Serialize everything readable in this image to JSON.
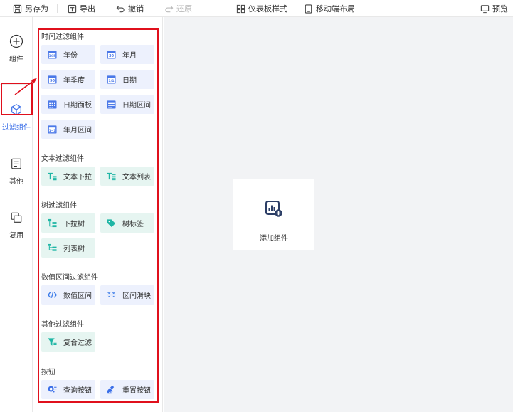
{
  "toolbar": {
    "save_as": "另存为",
    "export": "导出",
    "undo": "撤销",
    "redo": "还原",
    "dashboard_style": "仪表板样式",
    "mobile_layout": "移动端布局",
    "preview": "预览"
  },
  "rail": {
    "items": [
      {
        "label": "组件",
        "icon": "plus-circle-icon"
      },
      {
        "label": "过滤组件",
        "icon": "cube-icon",
        "active": true
      },
      {
        "label": "其他",
        "icon": "document-icon"
      },
      {
        "label": "复用",
        "icon": "copy-icon"
      }
    ]
  },
  "panel": {
    "sections": [
      {
        "title": "时间过滤组件",
        "items": [
          {
            "label": "年份",
            "icon": "calendar-365-icon",
            "color": "#4a78e8"
          },
          {
            "label": "年月",
            "icon": "calendar-30-icon",
            "color": "#4a78e8"
          },
          {
            "label": "年季度",
            "icon": "calendar-90-icon",
            "color": "#4a78e8"
          },
          {
            "label": "日期",
            "icon": "calendar-1-1-icon",
            "color": "#4a78e8"
          },
          {
            "label": "日期面板",
            "icon": "calendar-grid-icon",
            "color": "#4a78e8"
          },
          {
            "label": "日期区间",
            "icon": "calendar-range-icon",
            "color": "#4a78e8"
          },
          {
            "label": "年月区间",
            "icon": "calendar-month-range-icon",
            "color": "#4a78e8"
          }
        ]
      },
      {
        "title": "文本过滤组件",
        "items": [
          {
            "label": "文本下拉",
            "icon": "text-dropdown-icon",
            "color": "#1fb6a5"
          },
          {
            "label": "文本列表",
            "icon": "text-list-icon",
            "color": "#1fb6a5"
          }
        ]
      },
      {
        "title": "树过滤组件",
        "items": [
          {
            "label": "下拉树",
            "icon": "dropdown-tree-icon",
            "color": "#1fb6a5"
          },
          {
            "label": "树标签",
            "icon": "tree-tag-icon",
            "color": "#1fb6a5"
          },
          {
            "label": "列表树",
            "icon": "list-tree-icon",
            "color": "#1fb6a5"
          }
        ]
      },
      {
        "title": "数值区间过滤组件",
        "items": [
          {
            "label": "数值区间",
            "icon": "code-range-icon",
            "color": "#3a7be8"
          },
          {
            "label": "区间滑块",
            "icon": "range-slider-icon",
            "color": "#3a7be8"
          }
        ]
      },
      {
        "title": "其他过滤组件",
        "items": [
          {
            "label": "复合过滤",
            "icon": "funnel-icon",
            "color": "#1fb6a5"
          }
        ]
      },
      {
        "title": "按钮",
        "items": [
          {
            "label": "查询按钮",
            "icon": "search-button-icon",
            "color": "#3a6ee8"
          },
          {
            "label": "重置按钮",
            "icon": "reset-button-icon",
            "color": "#3a6ee8"
          }
        ]
      }
    ]
  },
  "canvas": {
    "add_component_label": "添加组件",
    "add_component_icon": "chart-add-icon"
  },
  "colors": {
    "highlight": "#e0101c",
    "accent": "#3a6ee8",
    "canvas_bg": "#f2f3f5"
  }
}
